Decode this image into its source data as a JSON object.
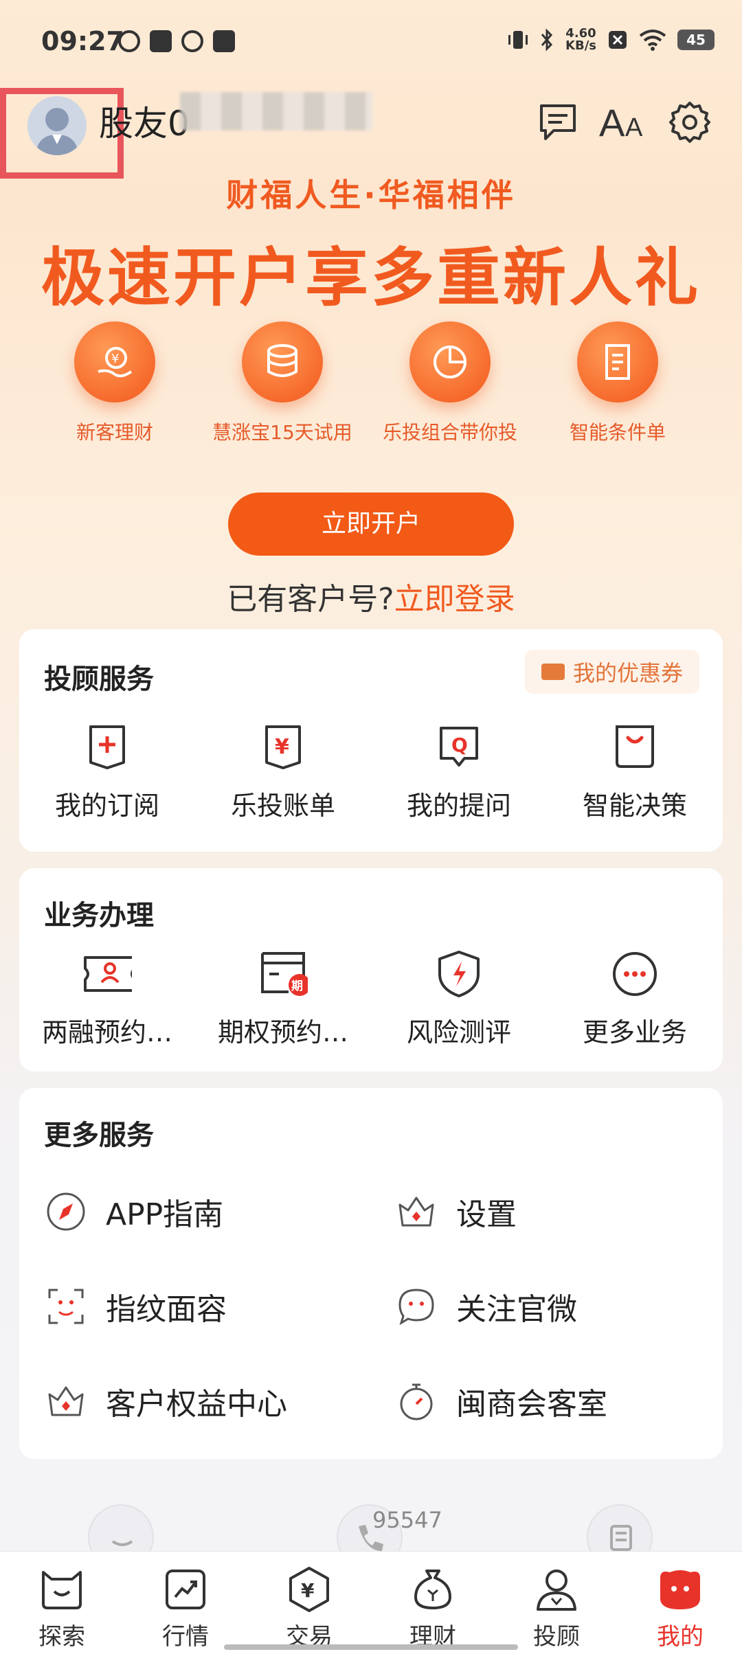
{
  "status_bar": {
    "time": "09:27",
    "net_speed_value": "4.60",
    "net_speed_unit": "KB/s",
    "battery": "45"
  },
  "header": {
    "username": "股友0"
  },
  "hero": {
    "slogan": "财福人生·华福相伴",
    "headline": "极速开户享多重新人礼",
    "features": [
      {
        "label": "新客理财",
        "icon": "yuan-hand-icon"
      },
      {
        "label": "慧涨宝15天试用",
        "icon": "coins-stack-icon"
      },
      {
        "label": "乐投组合带你投",
        "icon": "pie-chart-icon"
      },
      {
        "label": "智能条件单",
        "icon": "document-icon"
      }
    ],
    "open_button": "立即开户",
    "login_prompt": "已有客户号?",
    "login_link": "立即登录"
  },
  "advisor_services": {
    "title": "投顾服务",
    "coupon": "我的优惠券",
    "items": [
      {
        "label": "我的订阅",
        "icon": "plus-bookmark-icon"
      },
      {
        "label": "乐投账单",
        "icon": "yuan-bookmark-icon"
      },
      {
        "label": "我的提问",
        "icon": "question-bubble-icon"
      },
      {
        "label": "智能决策",
        "icon": "bag-icon"
      }
    ]
  },
  "business": {
    "title": "业务办理",
    "items": [
      {
        "label": "两融预约…",
        "icon": "id-card-icon"
      },
      {
        "label": "期权预约…",
        "icon": "calendar-option-icon"
      },
      {
        "label": "风险测评",
        "icon": "shield-bolt-icon"
      },
      {
        "label": "更多业务",
        "icon": "more-dots-icon"
      }
    ]
  },
  "more_services": {
    "title": "更多服务",
    "items": [
      {
        "label": "APP指南",
        "icon": "compass-icon"
      },
      {
        "label": "设置",
        "icon": "crown-icon"
      },
      {
        "label": "指纹面容",
        "icon": "face-scan-icon"
      },
      {
        "label": "关注官微",
        "icon": "chat-smile-icon"
      },
      {
        "label": "客户权益中心",
        "icon": "crown-icon"
      },
      {
        "label": "闽商会客室",
        "icon": "stopwatch-icon"
      }
    ]
  },
  "floating": {
    "phone_number": "95547"
  },
  "tab_bar": {
    "tabs": [
      {
        "label": "探索",
        "icon": "explore-icon"
      },
      {
        "label": "行情",
        "icon": "market-chart-icon"
      },
      {
        "label": "交易",
        "icon": "trade-yuan-icon"
      },
      {
        "label": "理财",
        "icon": "money-bag-icon"
      },
      {
        "label": "投顾",
        "icon": "advisor-icon"
      },
      {
        "label": "我的",
        "icon": "mine-face-icon"
      }
    ],
    "active_index": 5
  },
  "colors": {
    "accent": "#f25a16",
    "active_tab": "#e8332a",
    "highlight_box": "#e8555b"
  }
}
